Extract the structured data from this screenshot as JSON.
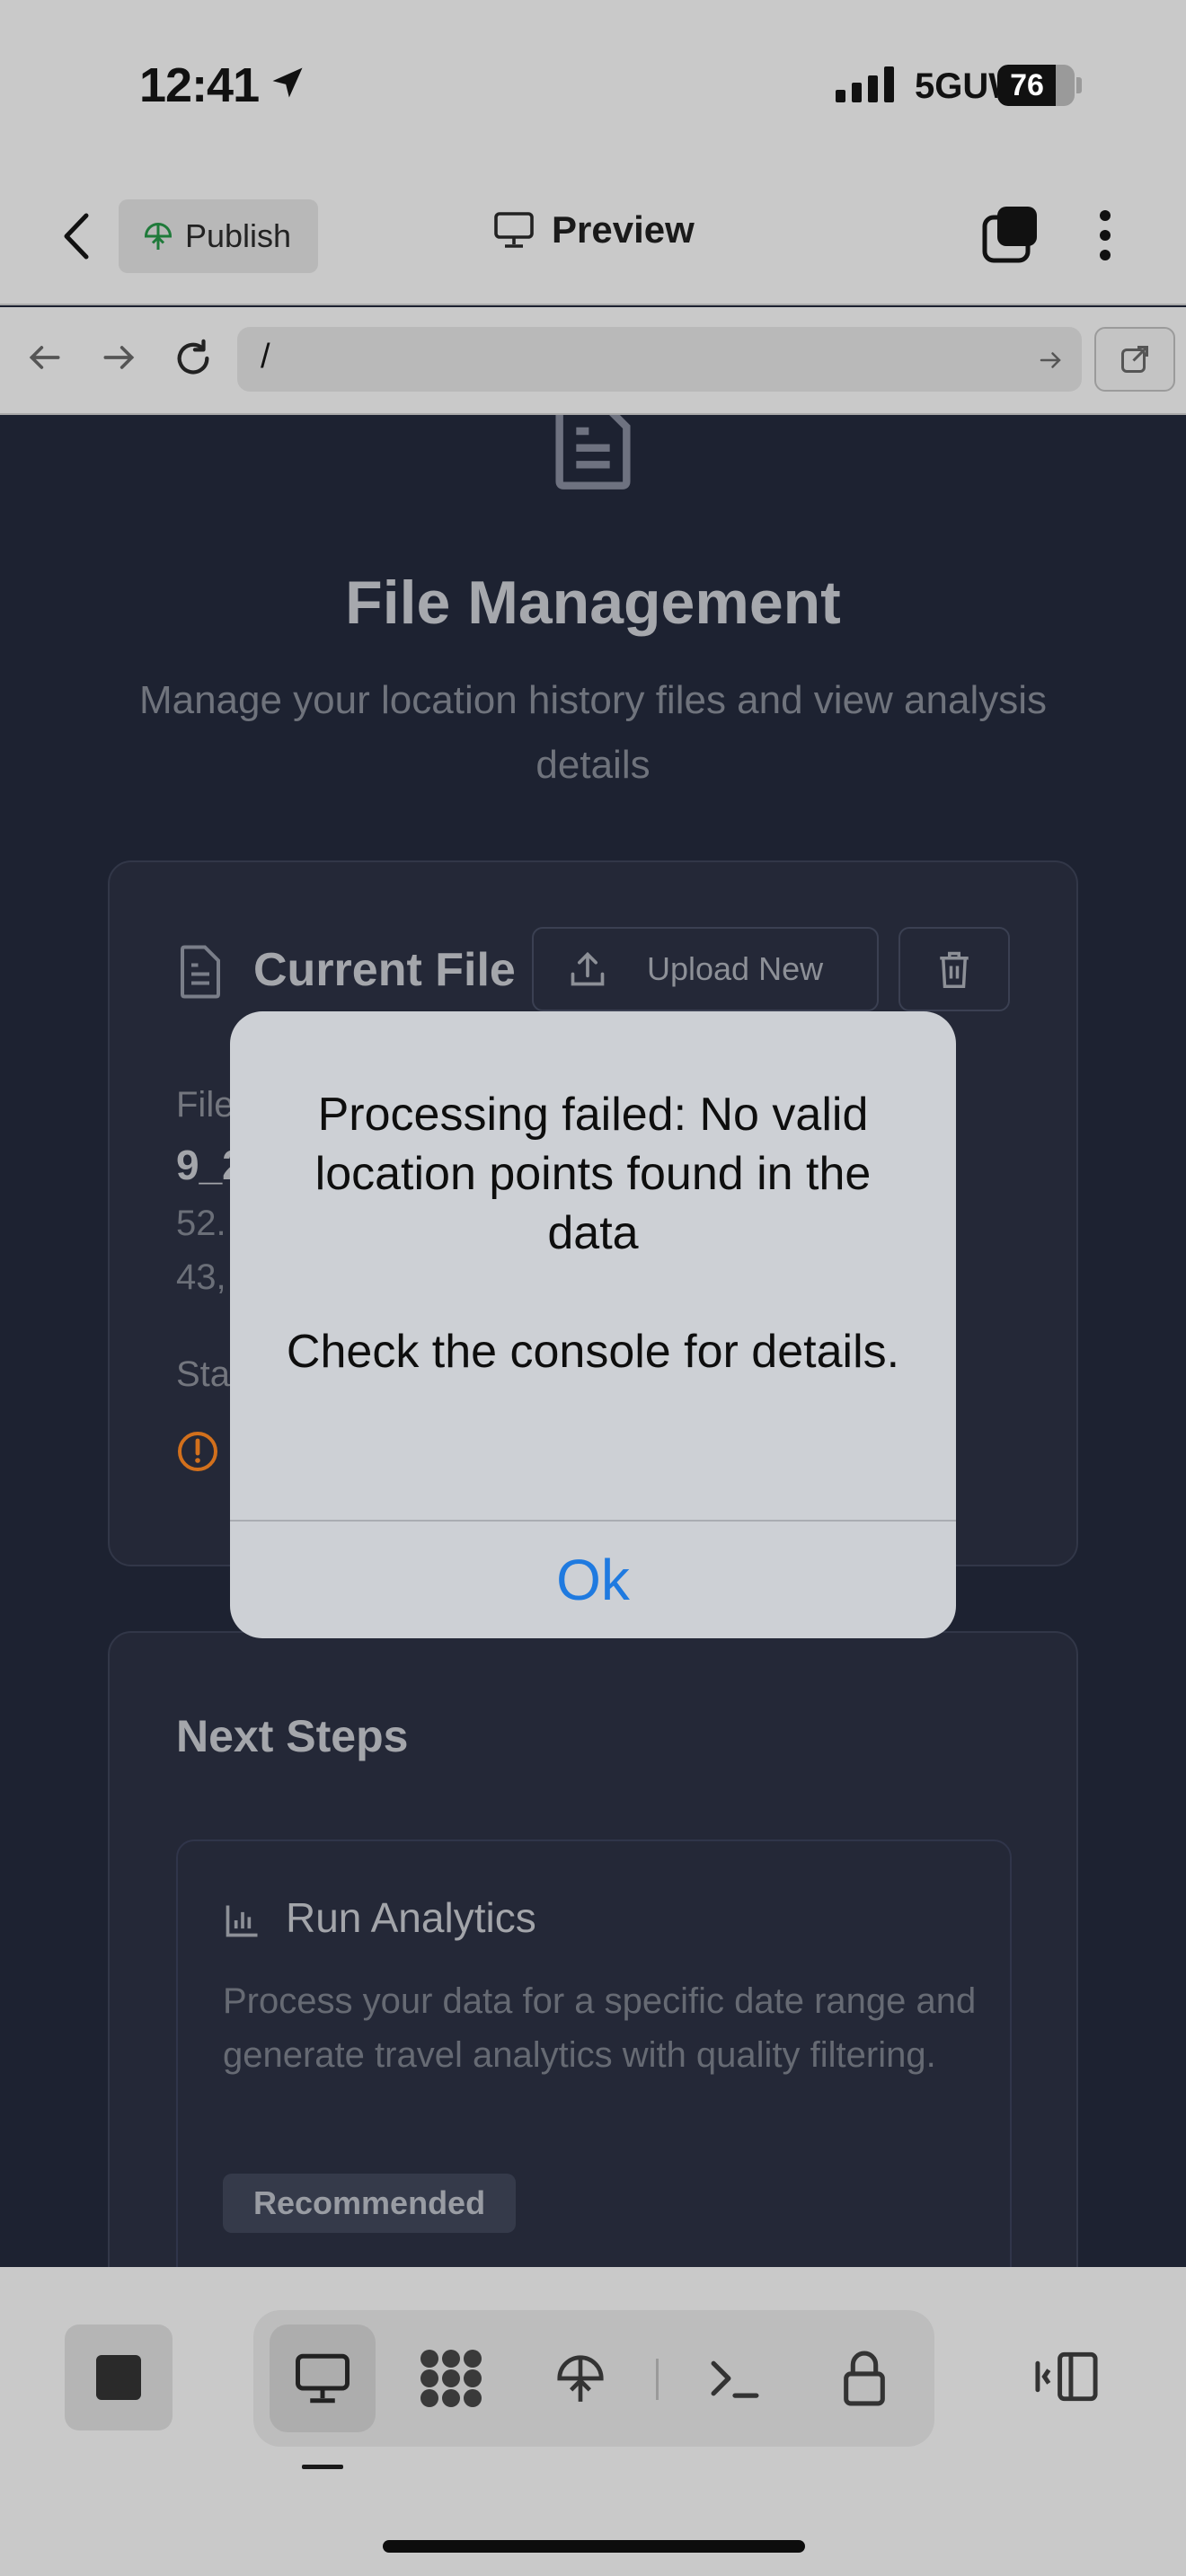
{
  "status_bar": {
    "time": "12:41",
    "network": "5GUW",
    "battery": "76",
    "battery_level": 0.76
  },
  "toolbar": {
    "publish_label": "Publish",
    "preview_label": "Preview"
  },
  "url_bar": {
    "url": "/"
  },
  "page": {
    "title": "File Management",
    "subtitle": "Manage your location history files and view analysis details",
    "current_file": {
      "title": "Current File",
      "upload_label": "Upload New",
      "file_label": "File",
      "file_name": "9_2",
      "file_size": "52.",
      "file_points": "43,",
      "status_label": "Sta"
    },
    "next_steps": {
      "title": "Next Steps",
      "item_title": "Run Analytics",
      "item_desc": "Process your data for a specific date range and generate travel analytics with quality filtering.",
      "badge": "Recommended"
    }
  },
  "alert": {
    "message": "Processing failed: No valid location points found in the data",
    "detail": "Check the console for details.",
    "ok_label": "Ok"
  },
  "colors": {
    "accent": "#1f7ae0",
    "warning": "#e07a1f",
    "publish_icon": "#1f7a3a"
  }
}
